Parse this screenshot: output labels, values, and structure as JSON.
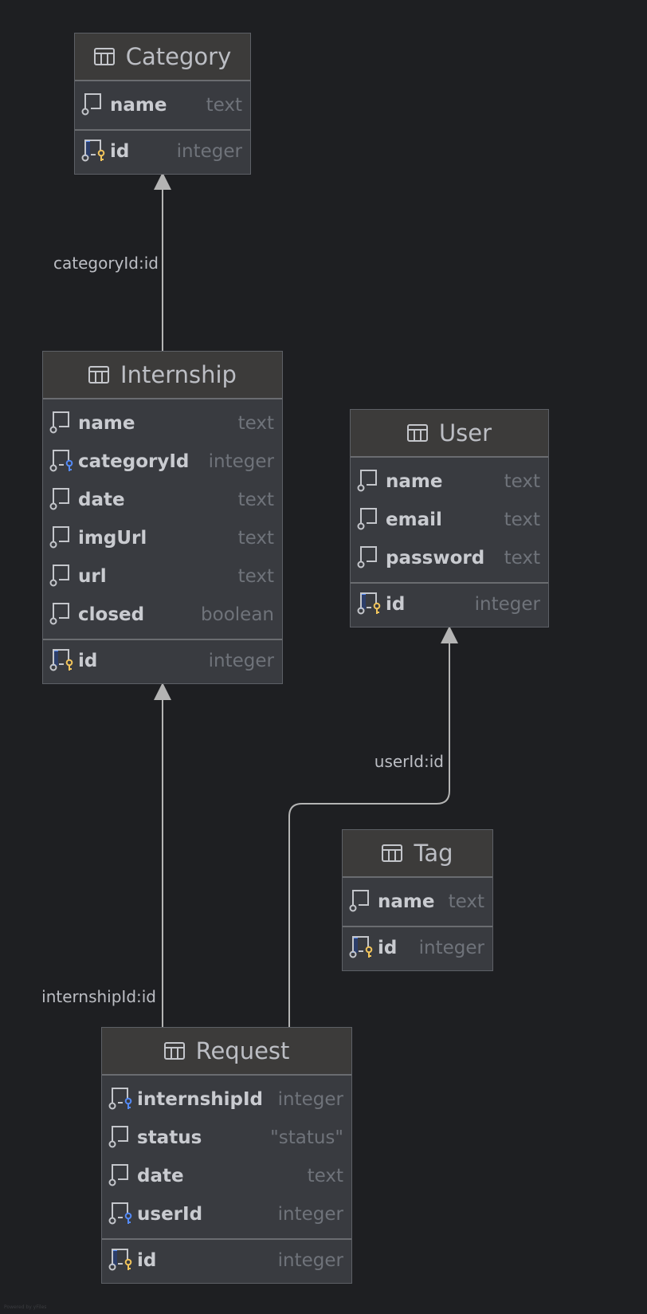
{
  "diagram": {
    "tables": [
      {
        "name": "Category",
        "columns": [
          {
            "name": "name",
            "type": "text",
            "key": "none"
          }
        ],
        "primary_key": {
          "name": "id",
          "type": "integer"
        }
      },
      {
        "name": "Internship",
        "columns": [
          {
            "name": "name",
            "type": "text",
            "key": "none"
          },
          {
            "name": "categoryId",
            "type": "integer",
            "key": "foreign"
          },
          {
            "name": "date",
            "type": "text",
            "key": "none"
          },
          {
            "name": "imgUrl",
            "type": "text",
            "key": "none"
          },
          {
            "name": "url",
            "type": "text",
            "key": "none"
          },
          {
            "name": "closed",
            "type": "boolean",
            "key": "none"
          }
        ],
        "primary_key": {
          "name": "id",
          "type": "integer"
        }
      },
      {
        "name": "User",
        "columns": [
          {
            "name": "name",
            "type": "text",
            "key": "none"
          },
          {
            "name": "email",
            "type": "text",
            "key": "none"
          },
          {
            "name": "password",
            "type": "text",
            "key": "none"
          }
        ],
        "primary_key": {
          "name": "id",
          "type": "integer"
        }
      },
      {
        "name": "Tag",
        "columns": [
          {
            "name": "name",
            "type": "text",
            "key": "none"
          }
        ],
        "primary_key": {
          "name": "id",
          "type": "integer"
        }
      },
      {
        "name": "Request",
        "columns": [
          {
            "name": "internshipId",
            "type": "integer",
            "key": "foreign"
          },
          {
            "name": "status",
            "type": "\"status\"",
            "key": "none"
          },
          {
            "name": "date",
            "type": "text",
            "key": "none"
          },
          {
            "name": "userId",
            "type": "integer",
            "key": "foreign"
          }
        ],
        "primary_key": {
          "name": "id",
          "type": "integer"
        }
      }
    ],
    "relations": [
      {
        "from": "Internship",
        "to": "Category",
        "label": "categoryId:id"
      },
      {
        "from": "Request",
        "to": "Internship",
        "label": "internshipId:id"
      },
      {
        "from": "Request",
        "to": "User",
        "label": "userId:id"
      }
    ],
    "footer": "Powered by yFiles"
  },
  "colors": {
    "background": "#1e1f22",
    "table_body": "#393b40",
    "table_header": "#3c3b3a",
    "primary_key": "#f2c55c",
    "foreign_key": "#548af7",
    "edge": "#b4b4b4"
  }
}
